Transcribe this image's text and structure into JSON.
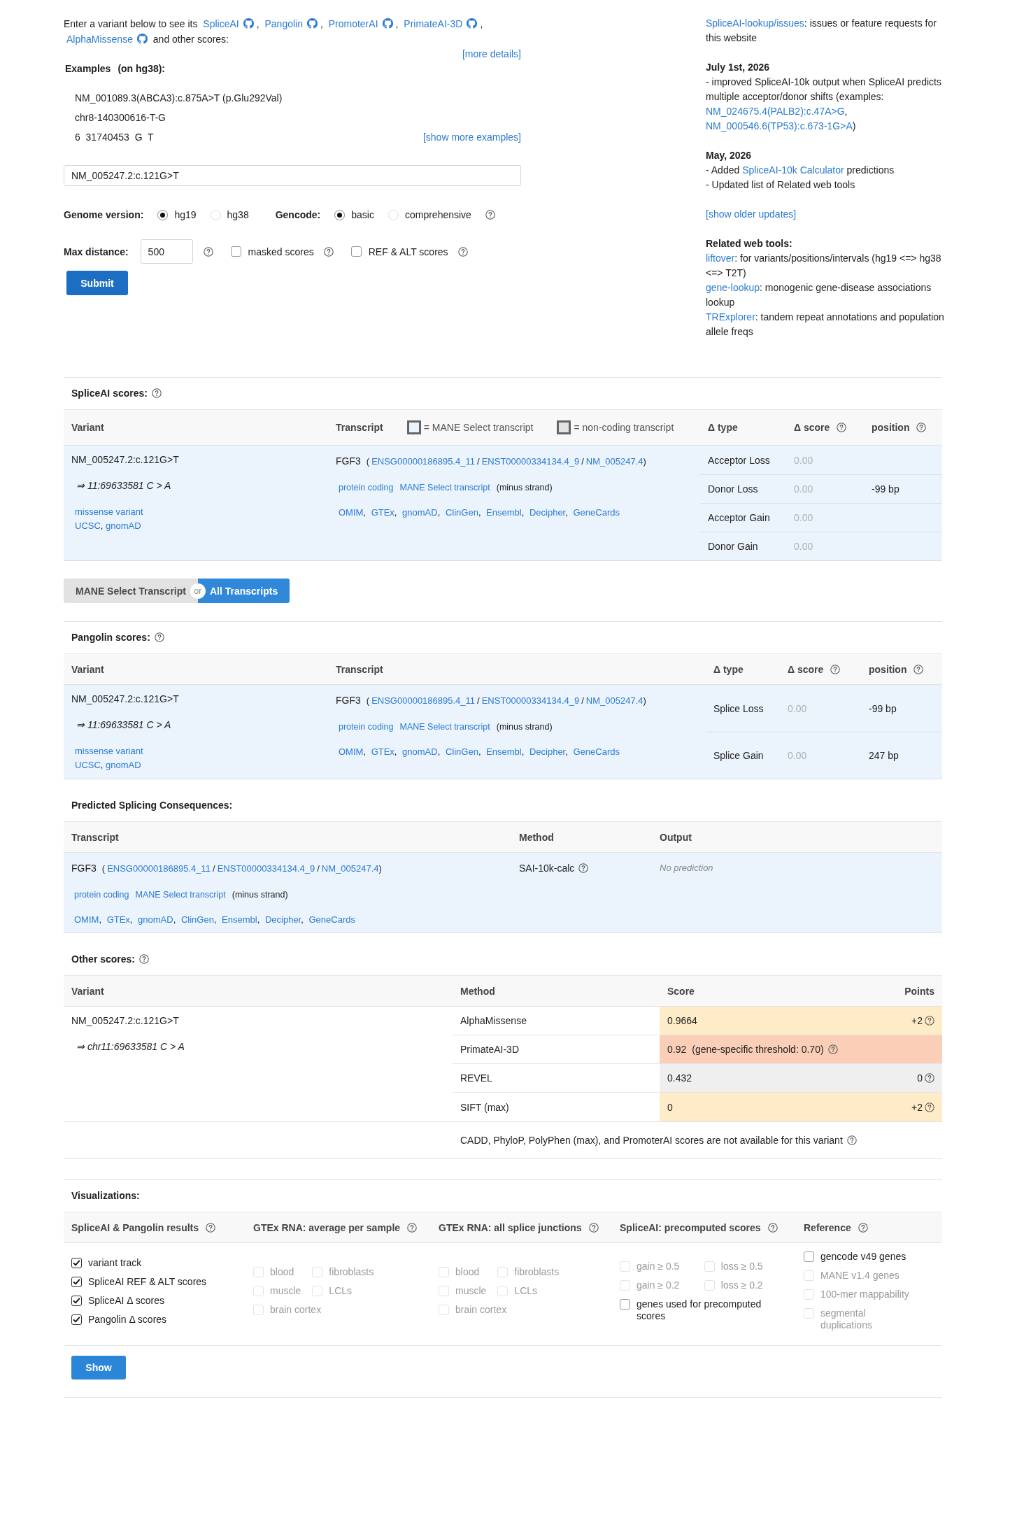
{
  "intro": {
    "segments": [
      {
        "kind": "text",
        "text": "Enter a variant below to see its "
      },
      {
        "kind": "tool",
        "text": "SpliceAI"
      },
      {
        "kind": "text",
        "text": ", "
      },
      {
        "kind": "tool",
        "text": "Pangolin"
      },
      {
        "kind": "text",
        "text": ", "
      },
      {
        "kind": "tool",
        "text": "PromoterAI"
      },
      {
        "kind": "text",
        "text": ", "
      },
      {
        "kind": "tool",
        "text": "PrimateAI-3D"
      },
      {
        "kind": "text",
        "text": ", "
      },
      {
        "kind": "tool",
        "text": "AlphaMissense"
      },
      {
        "kind": "text",
        "text": " and other scores:"
      }
    ],
    "more_details": "[more details]"
  },
  "examples": {
    "title": "Examples",
    "note": "(on hg38):",
    "items": [
      "NM_001089.3(ABCA3):c.875A>T (p.Glu292Val)",
      "chr8-140300616-T-G",
      "6  31740453  G  T"
    ],
    "show_more": "[show more examples]"
  },
  "variant_input": {
    "value": "NM_005247.2:c.121G>T"
  },
  "genome_version": {
    "label": "Genome version:",
    "options": [
      {
        "label": "hg19",
        "selected": true
      },
      {
        "label": "hg38",
        "selected": false
      }
    ]
  },
  "gencode": {
    "label": "Gencode:",
    "options": [
      {
        "label": "basic",
        "selected": true
      },
      {
        "label": "comprehensive",
        "selected": false
      }
    ],
    "help": true
  },
  "max_distance": {
    "label": "Max distance:",
    "value": "500",
    "help": true
  },
  "score_options": [
    {
      "label": "masked scores",
      "checked": false,
      "help": true
    },
    {
      "label": "REF & ALT scores",
      "checked": false,
      "help": true
    }
  ],
  "submit": "Submit",
  "news": {
    "issues": [
      {
        "kind": "link",
        "text": "SpliceAI-lookup/issues"
      },
      {
        "kind": "text",
        "text": ": issues or feature requests for this website"
      }
    ],
    "updates": [
      {
        "date": "July 1st, 2026",
        "lines": [
          [
            {
              "kind": "text",
              "text": "- improved SpliceAI-10k output when SpliceAI predicts multiple acceptor/donor shifts (examples: "
            },
            {
              "kind": "link",
              "text": "NM_024675.4(PALB2):c.47A>G"
            },
            {
              "kind": "text",
              "text": ", "
            },
            {
              "kind": "link",
              "text": "NM_000546.6(TP53):c.673-1G>A"
            },
            {
              "kind": "text",
              "text": ")"
            }
          ]
        ]
      },
      {
        "date": "May, 2026",
        "lines": [
          [
            {
              "kind": "text",
              "text": "- Added "
            },
            {
              "kind": "link",
              "text": "SpliceAI-10k Calculator"
            },
            {
              "kind": "text",
              "text": " predictions"
            }
          ],
          [
            {
              "kind": "text",
              "text": "- Updated list of Related web tools"
            }
          ]
        ]
      }
    ],
    "older": "[show older updates]",
    "related_title": "Related web tools:",
    "related": [
      [
        {
          "kind": "link",
          "text": "liftover"
        },
        {
          "kind": "text",
          "text": ": for variants/positions/intervals (hg19 <=> hg38 <=> T2T)"
        }
      ],
      [
        {
          "kind": "link",
          "text": "gene-lookup"
        },
        {
          "kind": "text",
          "text": ": monogenic gene-disease associations lookup"
        }
      ],
      [
        {
          "kind": "link",
          "text": "TRExplorer"
        },
        {
          "kind": "text",
          "text": ": tandem repeat annotations and population allele freqs"
        }
      ]
    ]
  },
  "spliceai": {
    "title": "SpliceAI scores:",
    "help": true,
    "columns": [
      {
        "label": "Variant"
      },
      {
        "label": "Transcript",
        "legend": [
          {
            "label": "= MANE Select transcript",
            "color": "#eaf2fc"
          },
          {
            "label": "= non-coding transcript",
            "color": "#e4e4e4"
          }
        ]
      },
      {
        "label": "Δ type"
      },
      {
        "label": "Δ score",
        "help": true
      },
      {
        "label": "position",
        "help": true
      }
    ],
    "variant": {
      "name": "NM_005247.2:c.121G>T",
      "coordinates": "⇒ 11:69633581 C > A",
      "consequence": "missense variant",
      "links": [
        {
          "kind": "link",
          "text": "UCSC"
        },
        {
          "kind": "text",
          "text": ", "
        },
        {
          "kind": "link",
          "text": "gnomAD"
        }
      ]
    },
    "transcript": {
      "gene": "FGF3",
      "ids": [
        {
          "kind": "text",
          "text": "("
        },
        {
          "kind": "link",
          "text": "ENSG00000186895.4_11"
        },
        {
          "kind": "text",
          "text": "/"
        },
        {
          "kind": "link",
          "text": "ENST00000334134.4_9"
        },
        {
          "kind": "text",
          "text": "/"
        },
        {
          "kind": "link",
          "text": "NM_005247.4"
        },
        {
          "kind": "text",
          "text": ")"
        }
      ],
      "tags": [
        {
          "kind": "link",
          "text": "protein coding"
        },
        {
          "kind": "link",
          "text": "MANE Select transcript"
        },
        {
          "kind": "text",
          "text": "(minus strand)"
        }
      ],
      "links": [
        {
          "kind": "link",
          "text": "OMIM"
        },
        {
          "kind": "text",
          "text": ", "
        },
        {
          "kind": "link",
          "text": "GTEx"
        },
        {
          "kind": "text",
          "text": ", "
        },
        {
          "kind": "link",
          "text": "gnomAD"
        },
        {
          "kind": "text",
          "text": ", "
        },
        {
          "kind": "link",
          "text": "ClinGen"
        },
        {
          "kind": "text",
          "text": ", "
        },
        {
          "kind": "link",
          "text": "Ensembl"
        },
        {
          "kind": "text",
          "text": ", "
        },
        {
          "kind": "link",
          "text": "Decipher"
        },
        {
          "kind": "text",
          "text": ", "
        },
        {
          "kind": "link",
          "text": "GeneCards"
        }
      ]
    },
    "rows": [
      {
        "type": "Acceptor Loss",
        "score": "0.00"
      },
      {
        "type": "Donor Loss",
        "score": "0.00",
        "position": "-99 bp"
      },
      {
        "type": "Acceptor Gain",
        "score": "0.00"
      },
      {
        "type": "Donor Gain",
        "score": "0.00"
      }
    ]
  },
  "transcript_toggle": {
    "options": [
      {
        "label": "MANE Select Transcript",
        "selected": false
      },
      {
        "label": "All Transcripts",
        "selected": true
      }
    ],
    "separator": "or"
  },
  "pangolin": {
    "title": "Pangolin scores:",
    "help": true,
    "columns": [
      {
        "label": "Variant"
      },
      {
        "label": "Transcript"
      },
      {
        "label": "Δ type"
      },
      {
        "label": "Δ score",
        "help": true
      },
      {
        "label": "position",
        "help": true
      }
    ],
    "variant": {
      "name": "NM_005247.2:c.121G>T",
      "coordinates": "⇒ 11:69633581 C > A",
      "consequence": "missense variant",
      "links": [
        {
          "kind": "link",
          "text": "UCSC"
        },
        {
          "kind": "text",
          "text": ", "
        },
        {
          "kind": "link",
          "text": "gnomAD"
        }
      ]
    },
    "transcript": {
      "gene": "FGF3",
      "ids": [
        {
          "kind": "text",
          "text": "("
        },
        {
          "kind": "link",
          "text": "ENSG00000186895.4_11"
        },
        {
          "kind": "text",
          "text": "/"
        },
        {
          "kind": "link",
          "text": "ENST00000334134.4_9"
        },
        {
          "kind": "text",
          "text": "/"
        },
        {
          "kind": "link",
          "text": "NM_005247.4"
        },
        {
          "kind": "text",
          "text": ")"
        }
      ],
      "tags": [
        {
          "kind": "link",
          "text": "protein coding"
        },
        {
          "kind": "link",
          "text": "MANE Select transcript"
        },
        {
          "kind": "text",
          "text": "(minus strand)"
        }
      ],
      "links": [
        {
          "kind": "link",
          "text": "OMIM"
        },
        {
          "kind": "text",
          "text": ", "
        },
        {
          "kind": "link",
          "text": "GTEx"
        },
        {
          "kind": "text",
          "text": ", "
        },
        {
          "kind": "link",
          "text": "gnomAD"
        },
        {
          "kind": "text",
          "text": ", "
        },
        {
          "kind": "link",
          "text": "ClinGen"
        },
        {
          "kind": "text",
          "text": ", "
        },
        {
          "kind": "link",
          "text": "Ensembl"
        },
        {
          "kind": "text",
          "text": ", "
        },
        {
          "kind": "link",
          "text": "Decipher"
        },
        {
          "kind": "text",
          "text": ", "
        },
        {
          "kind": "link",
          "text": "GeneCards"
        }
      ]
    },
    "rows": [
      {
        "type": "Splice Loss",
        "score": "0.00",
        "position": "-99 bp"
      },
      {
        "type": "Splice Gain",
        "score": "0.00",
        "position": "247 bp"
      }
    ]
  },
  "consequences": {
    "title": "Predicted Splicing Consequences:",
    "columns": [
      {
        "label": "Transcript"
      },
      {
        "label": "Method"
      },
      {
        "label": "Output"
      }
    ],
    "rows": [
      {
        "transcript": {
          "gene": "FGF3",
          "ids": [
            {
              "kind": "text",
              "text": "("
            },
            {
              "kind": "link",
              "text": "ENSG00000186895.4_11"
            },
            {
              "kind": "text",
              "text": "/"
            },
            {
              "kind": "link",
              "text": "ENST00000334134.4_9"
            },
            {
              "kind": "text",
              "text": "/"
            },
            {
              "kind": "link",
              "text": "NM_005247.4"
            },
            {
              "kind": "text",
              "text": ")"
            }
          ],
          "tags": [
            {
              "kind": "link",
              "text": "protein coding"
            },
            {
              "kind": "link",
              "text": "MANE Select transcript"
            },
            {
              "kind": "text",
              "text": "(minus strand)"
            }
          ],
          "links": [
            {
              "kind": "link",
              "text": "OMIM"
            },
            {
              "kind": "text",
              "text": ", "
            },
            {
              "kind": "link",
              "text": "GTEx"
            },
            {
              "kind": "text",
              "text": ", "
            },
            {
              "kind": "link",
              "text": "gnomAD"
            },
            {
              "kind": "text",
              "text": ", "
            },
            {
              "kind": "link",
              "text": "ClinGen"
            },
            {
              "kind": "text",
              "text": ", "
            },
            {
              "kind": "link",
              "text": "Ensembl"
            },
            {
              "kind": "text",
              "text": ", "
            },
            {
              "kind": "link",
              "text": "Decipher"
            },
            {
              "kind": "text",
              "text": ", "
            },
            {
              "kind": "link",
              "text": "GeneCards"
            }
          ]
        },
        "method": "SAI-10k-calc",
        "help": true,
        "output": "No prediction"
      }
    ]
  },
  "other_scores": {
    "title": "Other scores:",
    "help": true,
    "columns": [
      {
        "label": "Variant"
      },
      {
        "label": "Method"
      },
      {
        "label": "Score"
      },
      {
        "label": "Points"
      }
    ],
    "variant": {
      "name": "NM_005247.2:c.121G>T",
      "coordinates": "⇒ chr11:69633581 C > A"
    },
    "rows": [
      {
        "method": "AlphaMissense",
        "score": "0.9664",
        "points": "+2",
        "color": "#feebc8"
      },
      {
        "method": "PrimateAI-3D",
        "score": "0.92",
        "note": "(gene-specific threshold: 0.70)",
        "help": true,
        "color": "#fbcfb7"
      },
      {
        "method": "REVEL",
        "score": "0.432",
        "points": "0",
        "color": "#efefef"
      },
      {
        "method": "SIFT (max)",
        "score": "0",
        "points": "+2",
        "color": "#feebc8"
      }
    ],
    "note": {
      "text": "CADD, PhyloP, PolyPhen (max), and PromoterAI scores are not available for this variant",
      "help": true
    }
  },
  "visualizations": {
    "title": "Visualizations:",
    "groups": [
      {
        "title": "SpliceAI & Pangolin results",
        "help": true,
        "rows": [
          [
            {
              "label": "variant track",
              "checked": true,
              "disabled": false
            }
          ],
          [
            {
              "label": "SpliceAI REF & ALT scores",
              "checked": true,
              "disabled": false
            }
          ],
          [
            {
              "label": "SpliceAI Δ scores",
              "checked": true,
              "disabled": false
            }
          ],
          [
            {
              "label": "Pangolin Δ scores",
              "checked": true,
              "disabled": false
            }
          ]
        ]
      },
      {
        "title": "GTEx RNA: average per sample",
        "help": true,
        "rows": [
          [
            {
              "label": "blood",
              "checked": false,
              "disabled": true
            },
            {
              "label": "fibroblasts",
              "checked": false,
              "disabled": true
            }
          ],
          [
            {
              "label": "muscle",
              "checked": false,
              "disabled": true
            },
            {
              "label": "LCLs",
              "checked": false,
              "disabled": true
            }
          ],
          [
            {
              "label": "brain cortex",
              "checked": false,
              "disabled": true
            }
          ]
        ]
      },
      {
        "title": "GTEx RNA: all splice junctions",
        "help": true,
        "rows": [
          [
            {
              "label": "blood",
              "checked": false,
              "disabled": true
            },
            {
              "label": "fibroblasts",
              "checked": false,
              "disabled": true
            }
          ],
          [
            {
              "label": "muscle",
              "checked": false,
              "disabled": true
            },
            {
              "label": "LCLs",
              "checked": false,
              "disabled": true
            }
          ],
          [
            {
              "label": "brain cortex",
              "checked": false,
              "disabled": true
            }
          ]
        ]
      },
      {
        "title": "SpliceAI: precomputed scores",
        "help": true,
        "rows": [
          [
            {
              "label": "gain ≥ 0.5",
              "checked": false,
              "disabled": true
            },
            {
              "label": "loss ≥ 0.5",
              "checked": false,
              "disabled": true
            }
          ],
          [
            {
              "label": "gain ≥ 0.2",
              "checked": false,
              "disabled": true
            },
            {
              "label": "loss ≥ 0.2",
              "checked": false,
              "disabled": true
            }
          ],
          [
            {
              "label": "genes used for precomputed scores",
              "checked": false,
              "disabled": false
            }
          ]
        ]
      },
      {
        "title": "Reference",
        "help": true,
        "rows": [
          [
            {
              "label": "gencode v49 genes",
              "checked": false,
              "disabled": false
            }
          ],
          [
            {
              "label": "MANE v1.4 genes",
              "checked": false,
              "disabled": true
            }
          ],
          [
            {
              "label": "100-mer mappability",
              "checked": false,
              "disabled": true
            }
          ],
          [
            {
              "label": "segmental duplications",
              "checked": false,
              "disabled": true
            }
          ]
        ]
      }
    ],
    "show": "Show"
  }
}
